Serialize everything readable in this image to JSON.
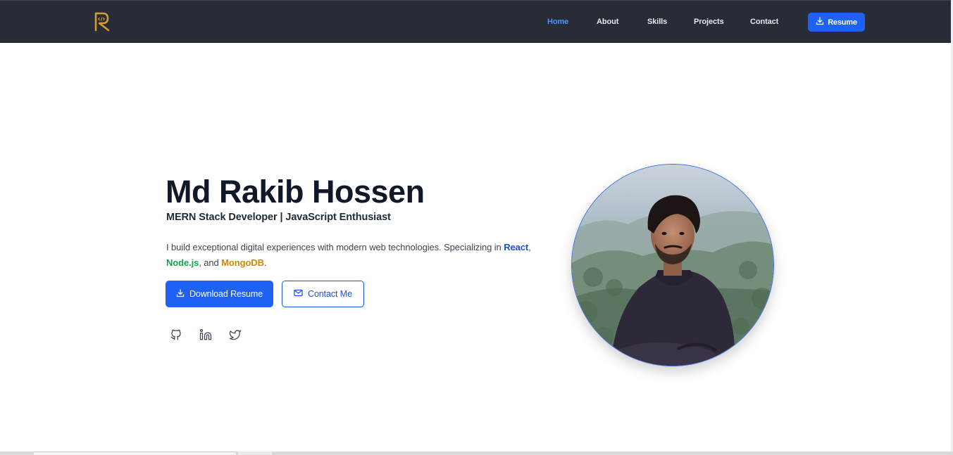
{
  "nav": {
    "logo_alt": "R",
    "links": [
      {
        "label": "Home",
        "active": true
      },
      {
        "label": "About",
        "active": false
      },
      {
        "label": "Skills",
        "active": false
      },
      {
        "label": "Projects",
        "active": false
      },
      {
        "label": "Contact",
        "active": false
      }
    ],
    "resume_label": "Resume"
  },
  "hero": {
    "name": "Md Rakib Hossen",
    "subtitle": "MERN Stack Developer | JavaScript Enthusiast",
    "desc_prefix": "I build exceptional digital experiences with modern web technologies. Specializing in",
    "tech_1": "React",
    "sep_1": ",",
    "tech_2": "Node.js",
    "sep_2": ", and",
    "tech_3": "MongoDB",
    "desc_suffix": ".",
    "download_label": "Download Resume",
    "contact_label": "Contact Me"
  },
  "social": [
    {
      "icon": "github-icon"
    },
    {
      "icon": "linkedin-icon"
    },
    {
      "icon": "twitter-icon"
    }
  ],
  "colors": {
    "navbar_bg": "#272c36",
    "active_link": "#4d94ff",
    "primary": "#1e62f5",
    "react": "#1d4ed8",
    "node": "#16a34a",
    "mongo": "#ca8a04",
    "logo_gold": "#d69a2d"
  }
}
